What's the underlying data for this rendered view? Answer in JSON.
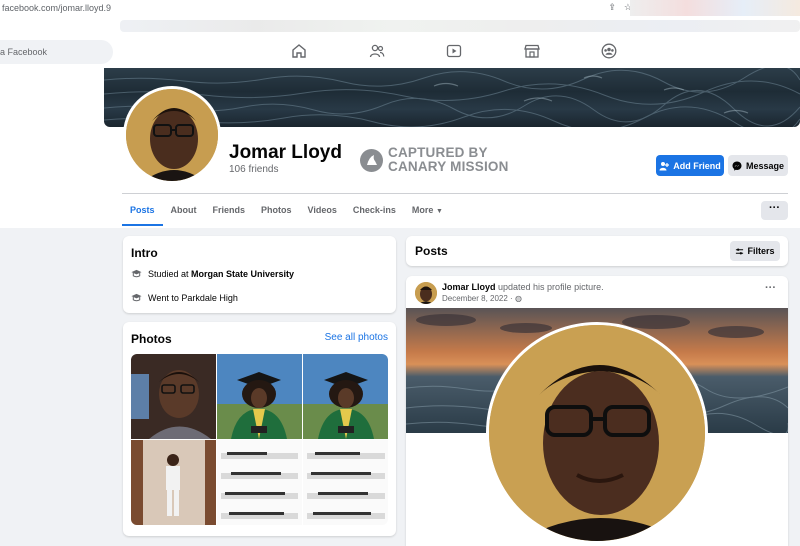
{
  "browser": {
    "url": "facebook.com/jomar.lloyd.9"
  },
  "search": {
    "placeholder": "a Facebook"
  },
  "nav": {
    "icons": [
      "home-icon",
      "friends-icon",
      "watch-icon",
      "marketplace-icon",
      "groups-icon"
    ]
  },
  "profile": {
    "name": "Jomar Lloyd",
    "friends": "106 friends",
    "watermark_line1": "CAPTURED BY",
    "watermark_line2": "CANARY MISSION",
    "add_friend": "Add Friend",
    "message": "Message"
  },
  "tabs": [
    "Posts",
    "About",
    "Friends",
    "Photos",
    "Videos",
    "Check-ins",
    "More"
  ],
  "intro": {
    "title": "Intro",
    "studied_prefix": "Studied at ",
    "studied_school": "Morgan State University",
    "went_to": "Went to Parkdale High"
  },
  "photos": {
    "title": "Photos",
    "see_all": "See all photos"
  },
  "posts": {
    "title": "Posts",
    "filters": "Filters",
    "author": "Jomar Lloyd",
    "action": " updated his profile picture.",
    "date": "December 8, 2022 · "
  },
  "colors": {
    "accent": "#1b74e4",
    "bg": "#f0f2f5"
  }
}
